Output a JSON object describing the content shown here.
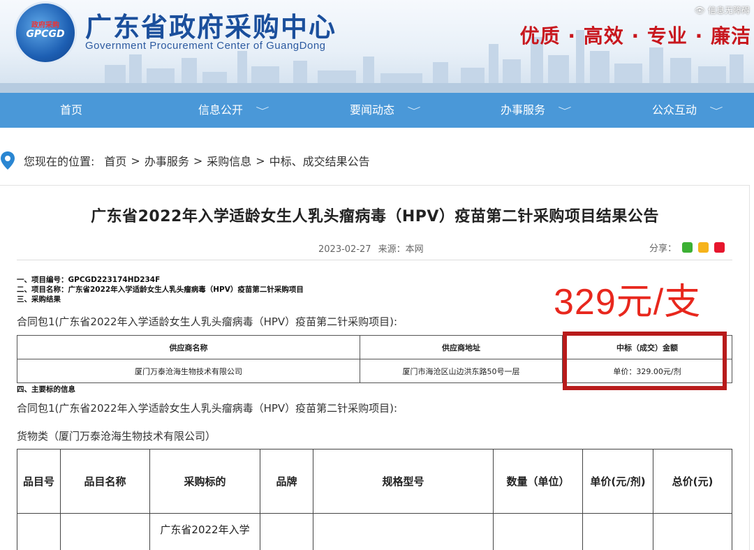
{
  "header": {
    "logo_top": "政府采购",
    "logo_main": "GPCGD",
    "title": "广东省政府采购中心",
    "subtitle": "Government Procurement Center of GuangDong",
    "slogan": "优质 · 高效 · 专业 · 廉洁",
    "accessibility": "信息无障碍"
  },
  "nav": {
    "items": [
      {
        "label": "首页"
      },
      {
        "label": "信息公开"
      },
      {
        "label": "要闻动态"
      },
      {
        "label": "办事服务"
      },
      {
        "label": "公众互动"
      }
    ]
  },
  "breadcrumb": {
    "prefix": "您现在的位置:",
    "items": [
      "首页",
      "办事服务",
      "采购信息",
      "中标、成交结果公告"
    ],
    "separator": ">"
  },
  "article": {
    "title": "广东省2022年入学适龄女生人乳头瘤病毒（HPV）疫苗第二针采购项目结果公告",
    "date": "2023-02-27",
    "source": "来源：本网",
    "share_label": "分享：",
    "line1": "一、项目编号：GPCGD223174HD234F",
    "line2": "二、项目名称：广东省2022年入学适龄女生人乳头瘤病毒（HPV）疫苗第二针采购项目",
    "line3": "三、采购结果",
    "package_line": "合同包1(广东省2022年入学适龄女生人乳头瘤病毒（HPV）疫苗第二针采购项目):",
    "price_callout": "329元/支",
    "supplier_table": {
      "headers": [
        "供应商名称",
        "供应商地址",
        "中标（成交）金额"
      ],
      "row": [
        "厦门万泰沧海生物技术有限公司",
        "厦门市海沧区山边洪东路50号一层",
        "单价：329.00元/剂"
      ]
    },
    "section4": "四、主要标的信息",
    "package_line2": "合同包1(广东省2022年入学适龄女生人乳头瘤病毒（HPV）疫苗第二针采购项目):",
    "goods_label": "货物类（厦门万泰沧海生物技术有限公司）",
    "goods_table": {
      "headers": [
        "品目号",
        "品目名称",
        "采购标的",
        "品牌",
        "规格型号",
        "数量（单位）",
        "单价(元/剂)",
        "总价(元)"
      ],
      "row": [
        "",
        "",
        "广东省2022年入学",
        "",
        "",
        "",
        "",
        ""
      ]
    }
  },
  "colors": {
    "nav_bg": "#4a98d8",
    "title_blue": "#1b4f9c",
    "slogan_red": "#c8171e",
    "callout_red": "#e8271d",
    "highlight_box": "#b81b1b"
  }
}
